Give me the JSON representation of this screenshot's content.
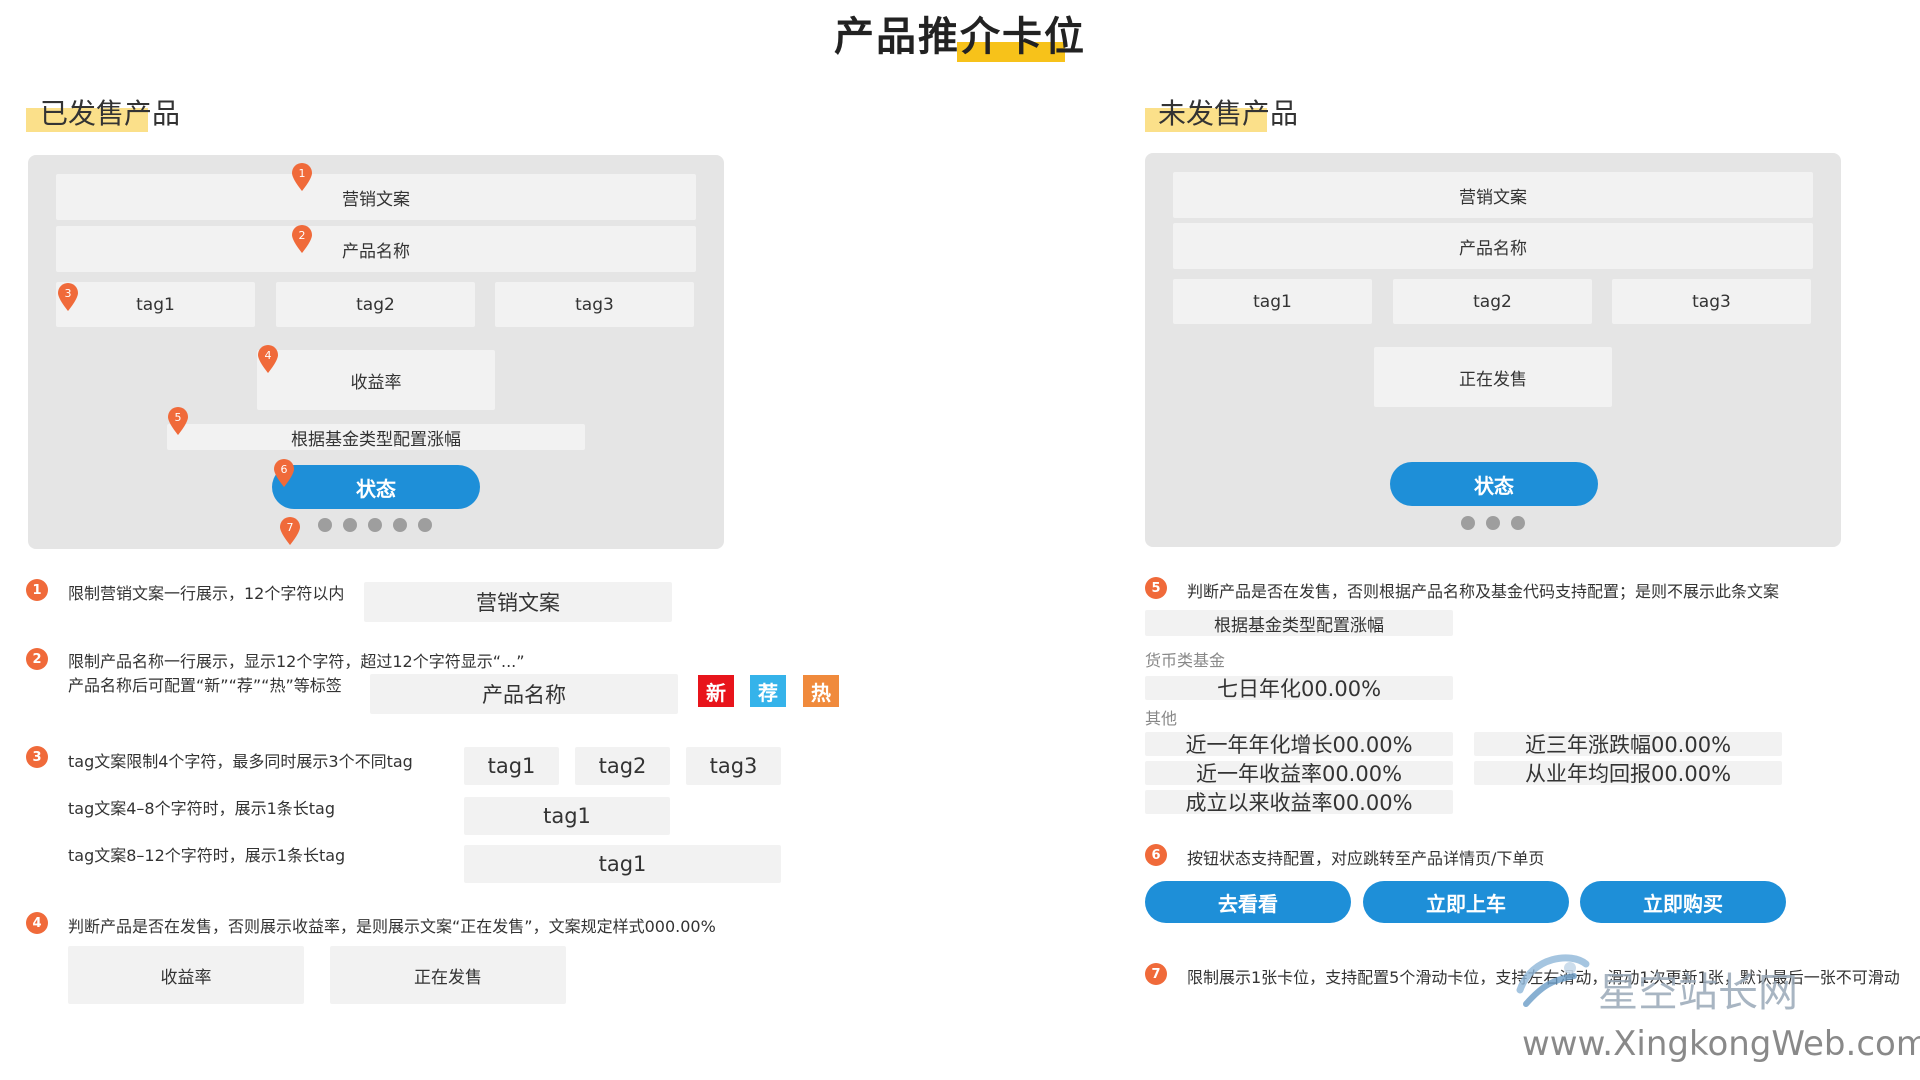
{
  "title": "产品推介卡位",
  "left": {
    "section_title": "已发售产品",
    "card": {
      "marketing": "营销文案",
      "name": "产品名称",
      "tags": [
        "tag1",
        "tag2",
        "tag3"
      ],
      "yield": "收益率",
      "config": "根据基金类型配置涨幅",
      "status": "状态",
      "dots_count": 5
    },
    "pins": [
      "1",
      "2",
      "3",
      "4",
      "5",
      "6",
      "7"
    ],
    "notes": {
      "n1": {
        "num": "1",
        "text": "限制营销文案一行展示，12个字符以内",
        "slot": "营销文案"
      },
      "n2": {
        "num": "2",
        "line1": "限制产品名称一行展示，显示12个字符，超过12个字符显示“...”",
        "line2": "产品名称后可配置“新”“荐”“热”等标签",
        "slot": "产品名称",
        "badges": [
          {
            "label": "新",
            "color": "#e8141b"
          },
          {
            "label": "荐",
            "color": "#35b3ea"
          },
          {
            "label": "热",
            "color": "#f08a3c"
          }
        ]
      },
      "n3": {
        "num": "3",
        "line1": "tag文案限制4个字符，最多同时展示3个不同tag",
        "line2": "tag文案4–8个字符时，展示1条长tag",
        "line3": "tag文案8–12个字符时，展示1条长tag",
        "tags": [
          "tag1",
          "tag2",
          "tag3"
        ],
        "long1": "tag1",
        "long2": "tag1"
      },
      "n4": {
        "num": "4",
        "text": "判断产品是否在发售，否则展示收益率，是则展示文案“正在发售”，文案规定样式000.00%",
        "slot1": "收益率",
        "slot2": "正在发售"
      }
    }
  },
  "right": {
    "section_title": "未发售产品",
    "card": {
      "marketing": "营销文案",
      "name": "产品名称",
      "tags": [
        "tag1",
        "tag2",
        "tag3"
      ],
      "selling": "正在发售",
      "status": "状态",
      "dots_count": 3
    },
    "notes": {
      "n5": {
        "num": "5",
        "text": "判断产品是否在发售，否则根据产品名称及基金代码支持配置；是则不展示此条文案",
        "config": "根据基金类型配置涨幅",
        "money_label": "货币类基金",
        "money_value": "七日年化00.00%",
        "other_label": "其他",
        "others": [
          "近一年年化增长00.00%",
          "近三年涨跌幅00.00%",
          "近一年收益率00.00%",
          "从业年均回报00.00%",
          "成立以来收益率00.00%"
        ]
      },
      "n6": {
        "num": "6",
        "text": "按钮状态支持配置，对应跳转至产品详情页/下单页",
        "buttons": [
          "去看看",
          "立即上车",
          "立即购买"
        ]
      },
      "n7": {
        "num": "7",
        "text": "限制展示1张卡位，支持配置5个滑动卡位，支持左右滑动，滑动1次更新1张，默认最后一张不可滑动"
      }
    }
  },
  "watermark": {
    "text": "星空站长网",
    "url": "www.XingkongWeb.com"
  },
  "colors": {
    "accent_blue": "#1e8fd8",
    "pin_orange": "#f06a3a",
    "highlight_yellow": "#f7c21a"
  }
}
